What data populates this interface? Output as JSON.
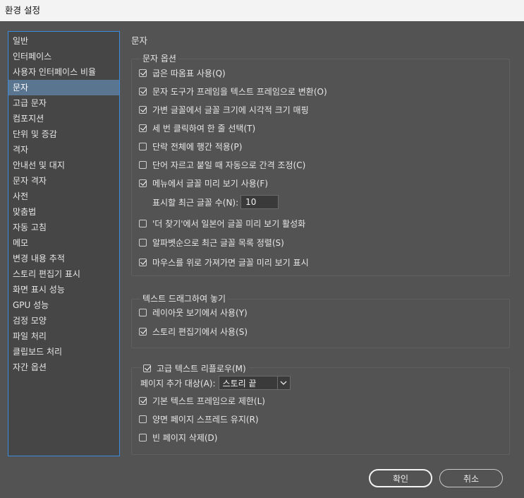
{
  "window": {
    "title": "환경 설정"
  },
  "sidebar": {
    "items": [
      {
        "label": "일반",
        "selected": false
      },
      {
        "label": "인터페이스",
        "selected": false
      },
      {
        "label": "사용자 인터페이스 비율",
        "selected": false
      },
      {
        "label": "문자",
        "selected": true
      },
      {
        "label": "고급 문자",
        "selected": false
      },
      {
        "label": "컴포지션",
        "selected": false
      },
      {
        "label": "단위 및 증감",
        "selected": false
      },
      {
        "label": "격자",
        "selected": false
      },
      {
        "label": "안내선 및 대지",
        "selected": false
      },
      {
        "label": "문자 격자",
        "selected": false
      },
      {
        "label": "사전",
        "selected": false
      },
      {
        "label": "맞춤법",
        "selected": false
      },
      {
        "label": "자동 고침",
        "selected": false
      },
      {
        "label": "메모",
        "selected": false
      },
      {
        "label": "변경 내용 추적",
        "selected": false
      },
      {
        "label": "스토리 편집기 표시",
        "selected": false
      },
      {
        "label": "화면 표시 성능",
        "selected": false
      },
      {
        "label": "GPU 성능",
        "selected": false
      },
      {
        "label": "검정 모양",
        "selected": false
      },
      {
        "label": "파일 처리",
        "selected": false
      },
      {
        "label": "클립보드 처리",
        "selected": false
      },
      {
        "label": "자간 옵션",
        "selected": false
      }
    ]
  },
  "page": {
    "heading": "문자"
  },
  "type_options": {
    "legend": "문자 옵션",
    "options": [
      {
        "label": "굽은 따옴표 사용(Q)",
        "checked": true
      },
      {
        "label": "문자 도구가 프레임을 텍스트 프레임으로 변환(O)",
        "checked": true
      },
      {
        "label": "가변 글꼴에서 글꼴 크기에 시각적 크기 매핑",
        "checked": true
      },
      {
        "label": "세 번 클릭하여 한 줄 선택(T)",
        "checked": true
      },
      {
        "label": "단락 전체에 행간 적용(P)",
        "checked": false
      },
      {
        "label": "단어 자르고 붙일 때 자동으로 간격 조정(C)",
        "checked": false
      },
      {
        "label": "메뉴에서 글꼴 미리 보기 사용(F)",
        "checked": true
      }
    ],
    "recent_fonts_label": "표시할 최근 글꼴 수(N):",
    "recent_fonts_value": "10",
    "options_after": [
      {
        "label": "'더 찾기'에서 일본어 글꼴 미리 보기 활성화",
        "checked": false
      },
      {
        "label": "알파벳순으로 최근 글꼴 목록 정렬(S)",
        "checked": false
      },
      {
        "label": "마우스를 위로 가져가면 글꼴 미리 보기 표시",
        "checked": true
      }
    ]
  },
  "drag_drop": {
    "legend": "텍스트 드래그하여 놓기",
    "options": [
      {
        "label": "레이아웃 보기에서 사용(Y)",
        "checked": false
      },
      {
        "label": "스토리 편집기에서 사용(S)",
        "checked": true
      }
    ]
  },
  "reflow": {
    "legend_label": "고급 텍스트 리플로우(M)",
    "legend_checked": true,
    "add_pages_label": "페이지 추가 대상(A):",
    "add_pages_value": "스토리 끝",
    "options": [
      {
        "label": "기본 텍스트 프레임으로 제한(L)",
        "checked": true
      },
      {
        "label": "양면 페이지 스프레드 유지(R)",
        "checked": false
      },
      {
        "label": "빈 페이지 삭제(D)",
        "checked": false
      }
    ]
  },
  "buttons": {
    "ok": "확인",
    "cancel": "취소"
  }
}
